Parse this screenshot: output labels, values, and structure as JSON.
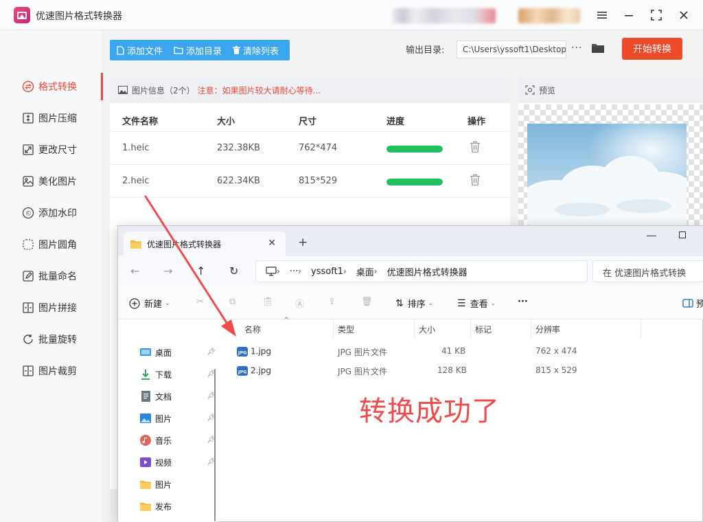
{
  "app": {
    "title": "优速图片格式转换器",
    "output_label": "输出目录:",
    "output_path": "C:\\Users\\yssoft1\\Desktop",
    "start_button": "开始转换",
    "toolbar": {
      "add_file": "添加文件",
      "add_dir": "添加目录",
      "clear_list": "清除列表"
    }
  },
  "sidebar": {
    "items": [
      {
        "label": "格式转换",
        "active": true
      },
      {
        "label": "图片压缩"
      },
      {
        "label": "更改尺寸"
      },
      {
        "label": "美化图片"
      },
      {
        "label": "添加水印"
      },
      {
        "label": "图片圆角"
      },
      {
        "label": "批量命名"
      },
      {
        "label": "图片拼接"
      },
      {
        "label": "批量旋转"
      },
      {
        "label": "图片裁剪"
      }
    ]
  },
  "file_list": {
    "info": "图片信息（2个）",
    "warning": "注意：如果图片较大请耐心等待...",
    "columns": [
      "文件名称",
      "大小",
      "尺寸",
      "进度",
      "操作"
    ],
    "rows": [
      {
        "name": "1.heic",
        "size": "232.38KB",
        "dims": "762*474",
        "progress": 1.0
      },
      {
        "name": "2.heic",
        "size": "622.34KB",
        "dims": "815*529",
        "progress": 1.0
      }
    ]
  },
  "preview": {
    "label": "预览"
  },
  "explorer": {
    "tab_title": "优速图片格式转换器",
    "breadcrumbs": [
      "yssoft1",
      "桌面",
      "优速图片格式转换器"
    ],
    "more": "···",
    "search_placeholder": "在 优速图片格式转换",
    "commands": {
      "new": "新建",
      "sort": "排序",
      "view": "查看",
      "more": "···",
      "details": "预"
    },
    "nav": [
      {
        "label": "桌面",
        "icon": "desktop-icon"
      },
      {
        "label": "下载",
        "icon": "download-icon"
      },
      {
        "label": "文档",
        "icon": "document-icon"
      },
      {
        "label": "图片",
        "icon": "pictures-icon"
      },
      {
        "label": "音乐",
        "icon": "music-icon"
      },
      {
        "label": "视频",
        "icon": "video-icon"
      },
      {
        "label": "图片",
        "icon": "folder-icon"
      },
      {
        "label": "发布",
        "icon": "folder-icon"
      }
    ],
    "columns": [
      "名称",
      "类型",
      "大小",
      "标记",
      "分辨率"
    ],
    "files": [
      {
        "name": "1.jpg",
        "type": "JPG 图片文件",
        "size": "41 KB",
        "tag": "",
        "resolution": "762 x 474"
      },
      {
        "name": "2.jpg",
        "type": "JPG 图片文件",
        "size": "128 KB",
        "tag": "",
        "resolution": "815 x 529"
      }
    ]
  },
  "annotation": {
    "text": "转换成功了",
    "color": "#f04a4a"
  },
  "colors": {
    "accent": "#e84a3c",
    "toolbar_blue": "#3ba6ec",
    "progress_green": "#22c060",
    "start_red": "#ee4b2b"
  }
}
